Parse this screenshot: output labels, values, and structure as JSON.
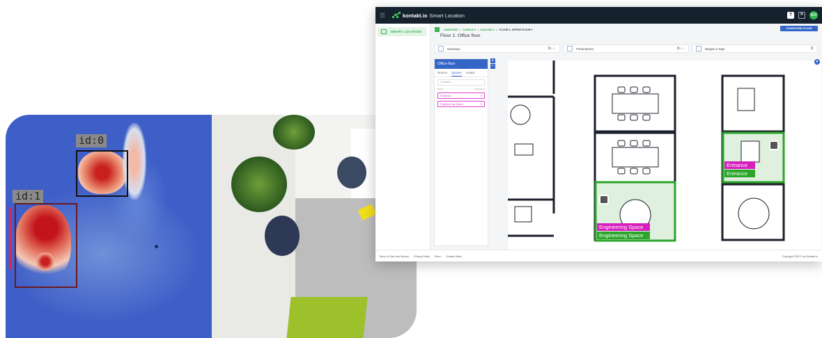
{
  "detections": [
    {
      "label": "id:0"
    },
    {
      "label": "id:1"
    }
  ],
  "app": {
    "title_brand": "kontakt.io",
    "title_product": "Smart Location",
    "avatar_initials": "KO",
    "help_icon": "?",
    "sidebar": {
      "items": [
        {
          "label": "SMART LOCATION"
        }
      ]
    },
    "breadcrumb": [
      {
        "label": "CAMPUSES"
      },
      {
        "label": "CAMPUS ▾"
      },
      {
        "label": "BUILDING ▾"
      },
      {
        "label": "FLOOR 1: OFFICE FLOOR ▾"
      }
    ],
    "separator": "/",
    "floor_title": "Floor 1: Office floor",
    "configure_button": "CONFIGURE FLOOR",
    "stats": [
      {
        "label": "Gateways",
        "value": "0",
        "sub": "0 / 0"
      },
      {
        "label": "Portal Beams",
        "value": "0",
        "sub": "0 / 0"
      },
      {
        "label": "Badges & Tags",
        "value": "0",
        "sub": ""
      }
    ],
    "panel": {
      "title": "Office floor",
      "tabs": [
        "Rooms",
        "Spaces",
        "Assets"
      ],
      "active_tab": "Spaces",
      "search_placeholder": "Search",
      "col_name": "Name",
      "col_occupancy": "Occupancy",
      "spaces": [
        {
          "name": "Entrance",
          "count": "0"
        },
        {
          "name": "Engineering Space",
          "count": "0"
        }
      ]
    },
    "zoom_in": "+",
    "zoom_out": "−",
    "filter_icon": "▼",
    "plan_labels": {
      "entrance_tag": "Entrance",
      "entrance_name": "Entrance",
      "engineering_tag": "Engineering Space",
      "engineering_name": "Engineering Space"
    },
    "footer": {
      "links": [
        "Terms of Sale and Service",
        "Privacy Policy",
        "Store",
        "Contact Sales"
      ],
      "copyright": "Copyright 2022 © by Kontakt.io"
    }
  },
  "colors": {
    "brand_green": "#2fb34b",
    "accent_blue": "#3466c8",
    "space_magenta": "#e13fd0",
    "zone_fill": "#dff0df",
    "zone_border": "#2aa52a"
  }
}
